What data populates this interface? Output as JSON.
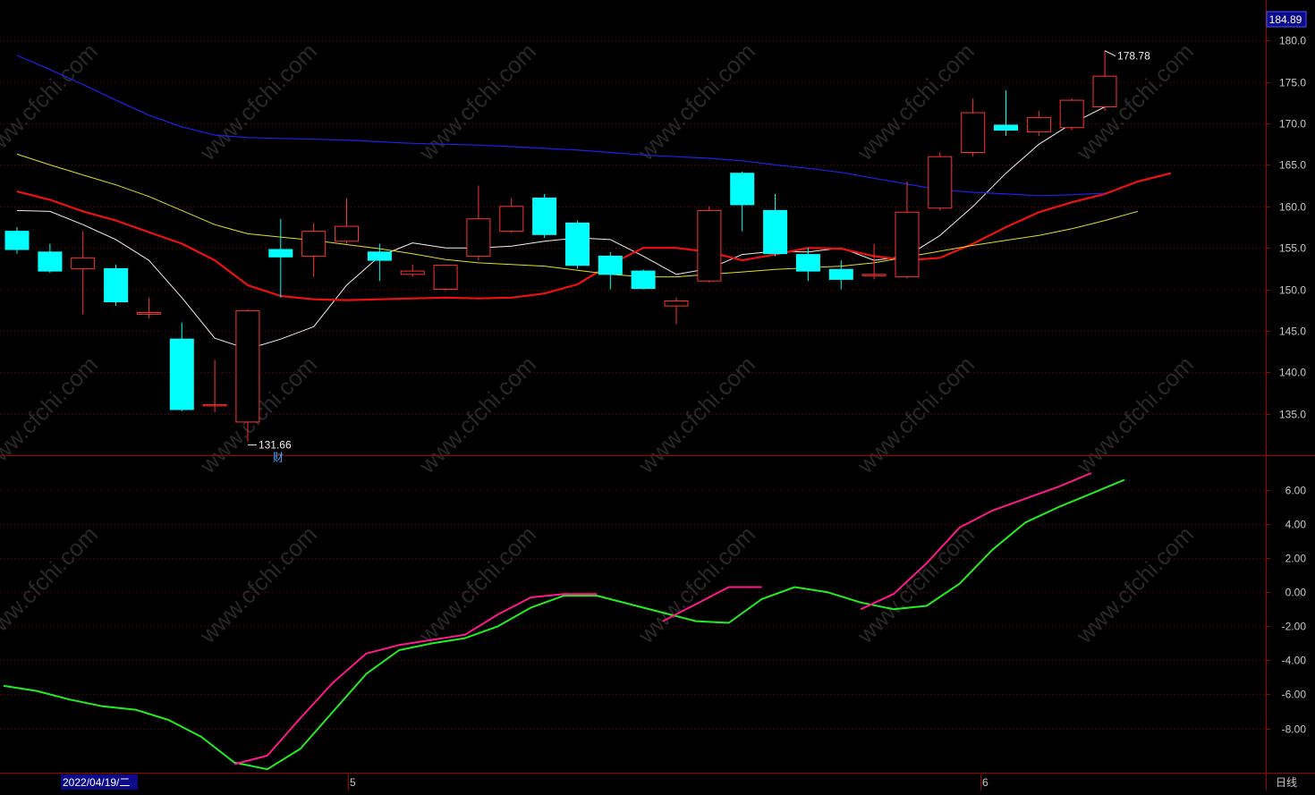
{
  "colors": {
    "background": "#000000",
    "frame": "#a00000",
    "grid": "#7a0000",
    "up_candle": "#ff3232",
    "down_candle": "#00ffff",
    "ma5": "#f0f0f0",
    "ma10": "#ee1111",
    "ma20": "#e0e020",
    "ma60": "#2020ee",
    "osc_fast": "#ff1a8c",
    "osc_slow": "#22ee22",
    "text": "#c8c8c8",
    "price_badge_bg": "#0a0a8a"
  },
  "watermark": "www.cfchi.com",
  "price_axis": {
    "top_price_badge": "184.89",
    "tick_labels": [
      "180.0",
      "175.0",
      "170.0",
      "165.0",
      "160.0",
      "155.0",
      "150.0",
      "145.0",
      "140.0",
      "135.0"
    ]
  },
  "osc_axis": {
    "tick_labels": [
      "6.00",
      "4.00",
      "2.00",
      "0.00",
      "-2.00",
      "-4.00",
      "-6.00",
      "-8.00"
    ]
  },
  "annotations": {
    "high_label": "178.78",
    "low_label": "131.66",
    "finance_marker": "财"
  },
  "bottom_bar": {
    "date_label": "2022/04/19/二",
    "month_mark_1": "5",
    "month_mark_2": "6",
    "period_label": "日线"
  },
  "chart_data": [
    {
      "type": "candlestick",
      "title": "",
      "ylim": [
        130,
        184.89
      ],
      "grid": true,
      "candles": [
        {
          "o": 157.0,
          "h": 157.5,
          "l": 154.3,
          "c": 154.8
        },
        {
          "o": 154.5,
          "h": 155.5,
          "l": 152.0,
          "c": 152.2
        },
        {
          "o": 152.5,
          "h": 157.0,
          "l": 147.0,
          "c": 153.8
        },
        {
          "o": 152.5,
          "h": 153.0,
          "l": 148.0,
          "c": 148.5
        },
        {
          "o": 147.0,
          "h": 149.0,
          "l": 146.5,
          "c": 147.2
        },
        {
          "o": 144.0,
          "h": 146.0,
          "l": 135.3,
          "c": 135.5
        },
        {
          "o": 136.0,
          "h": 141.5,
          "l": 135.2,
          "c": 136.1
        },
        {
          "o": 134.0,
          "h": 147.6,
          "l": 131.66,
          "c": 147.4
        },
        {
          "o": 154.8,
          "h": 158.5,
          "l": 149.0,
          "c": 153.9
        },
        {
          "o": 154.0,
          "h": 158.0,
          "l": 151.5,
          "c": 157.0
        },
        {
          "o": 155.8,
          "h": 161.0,
          "l": 155.5,
          "c": 157.6
        },
        {
          "o": 154.5,
          "h": 155.5,
          "l": 151.0,
          "c": 153.5
        },
        {
          "o": 151.8,
          "h": 153.0,
          "l": 151.5,
          "c": 152.2
        },
        {
          "o": 150.0,
          "h": 153.0,
          "l": 149.8,
          "c": 152.9
        },
        {
          "o": 154.0,
          "h": 162.5,
          "l": 153.5,
          "c": 158.5
        },
        {
          "o": 157.0,
          "h": 161.0,
          "l": 156.8,
          "c": 160.0
        },
        {
          "o": 161.0,
          "h": 161.5,
          "l": 156.2,
          "c": 156.6
        },
        {
          "o": 158.0,
          "h": 158.3,
          "l": 152.5,
          "c": 152.9
        },
        {
          "o": 154.0,
          "h": 154.5,
          "l": 150.0,
          "c": 151.8
        },
        {
          "o": 152.2,
          "h": 152.4,
          "l": 150.0,
          "c": 150.1
        },
        {
          "o": 148.0,
          "h": 149.0,
          "l": 145.8,
          "c": 148.6
        },
        {
          "o": 151.0,
          "h": 160.0,
          "l": 150.8,
          "c": 159.5
        },
        {
          "o": 164.0,
          "h": 164.2,
          "l": 157.0,
          "c": 160.2
        },
        {
          "o": 159.5,
          "h": 161.5,
          "l": 154.0,
          "c": 154.3
        },
        {
          "o": 154.2,
          "h": 155.0,
          "l": 151.0,
          "c": 152.2
        },
        {
          "o": 152.4,
          "h": 153.5,
          "l": 150.0,
          "c": 151.2
        },
        {
          "o": 151.7,
          "h": 155.5,
          "l": 151.2,
          "c": 151.8
        },
        {
          "o": 151.5,
          "h": 163.0,
          "l": 151.3,
          "c": 159.3
        },
        {
          "o": 159.8,
          "h": 166.5,
          "l": 159.5,
          "c": 166.0
        },
        {
          "o": 166.5,
          "h": 173.0,
          "l": 166.0,
          "c": 171.3
        },
        {
          "o": 169.8,
          "h": 174.0,
          "l": 168.5,
          "c": 169.2
        },
        {
          "o": 169.0,
          "h": 171.5,
          "l": 168.5,
          "c": 170.7
        },
        {
          "o": 169.5,
          "h": 173.0,
          "l": 169.2,
          "c": 172.8
        },
        {
          "o": 172.0,
          "h": 178.78,
          "l": 171.5,
          "c": 175.7
        }
      ],
      "series": [
        {
          "key": "ma5",
          "values": [
            159.5,
            159.4,
            157.8,
            156.0,
            153.5,
            149.0,
            144.1,
            142.8,
            144.0,
            145.5,
            150.5,
            154.0,
            155.6,
            155.0,
            155.0,
            155.2,
            155.8,
            156.2,
            156.0,
            154.0,
            151.8,
            152.5,
            154.2,
            154.6,
            154.5,
            155.0,
            153.5,
            154.0,
            156.5,
            160.0,
            164.0,
            167.5,
            170.0,
            172.0
          ]
        },
        {
          "key": "ma10",
          "values": [
            161.8,
            160.8,
            159.4,
            158.3,
            156.9,
            155.5,
            153.5,
            150.5,
            149.2,
            148.8,
            148.7,
            148.8,
            148.9,
            149.0,
            148.9,
            149.0,
            149.5,
            150.6,
            153.0,
            155.0,
            155.0,
            154.5,
            153.5,
            154.2,
            155.0,
            154.9,
            154.0,
            153.5,
            153.8,
            155.5,
            157.5,
            159.3,
            160.5,
            161.5,
            163.0,
            164.0
          ]
        },
        {
          "key": "ma20",
          "values": [
            166.3,
            165.0,
            163.8,
            162.6,
            161.2,
            159.5,
            157.8,
            156.7,
            156.3,
            155.9,
            155.4,
            154.9,
            154.3,
            153.6,
            153.2,
            153.0,
            152.8,
            152.3,
            151.8,
            151.5,
            151.5,
            151.8,
            152.1,
            152.4,
            152.6,
            152.8,
            153.2,
            153.9,
            154.6,
            155.3,
            155.9,
            156.5,
            157.3,
            158.3,
            159.4
          ]
        },
        {
          "key": "ma60",
          "values": [
            178.2,
            176.5,
            174.7,
            172.8,
            171.0,
            169.6,
            168.6,
            168.3,
            168.2,
            168.1,
            168.0,
            167.8,
            167.6,
            167.5,
            167.4,
            167.2,
            167.0,
            166.8,
            166.5,
            166.2,
            166.0,
            165.8,
            165.5,
            165.0,
            164.6,
            164.1,
            163.4,
            162.7,
            162.0,
            161.7,
            161.5,
            161.3,
            161.4,
            161.6
          ]
        }
      ]
    },
    {
      "type": "line",
      "title": "",
      "ylim": [
        -10.6,
        8.0
      ],
      "grid": true,
      "series": [
        {
          "key": "osc_slow",
          "values": [
            -5.5,
            -5.8,
            -6.3,
            -6.7,
            -6.9,
            -7.5,
            -8.5,
            -10.0,
            -10.4,
            -9.2,
            -7.0,
            -4.8,
            -3.4,
            -3.0,
            -2.7,
            -2.0,
            -0.9,
            -0.2,
            -0.2,
            -0.7,
            -1.2,
            -1.7,
            -1.8,
            -0.4,
            0.3,
            0.0,
            -0.6,
            -1.0,
            -0.8,
            0.5,
            2.5,
            4.1,
            5.0,
            5.8,
            6.6
          ]
        },
        {
          "key": "osc_fast",
          "segments": [
            [
              7,
              7,
              [
                -10.1,
                -9.6,
                -7.4,
                -5.3,
                -3.6,
                -3.1,
                -2.8,
                -2.5,
                -1.3,
                -0.3,
                -0.1,
                -0.1
              ]
            ],
            [
              20,
              20,
              [
                -1.7,
                -0.7,
                0.3,
                0.3
              ]
            ],
            [
              26,
              26,
              [
                -1.0,
                -0.1,
                1.7,
                3.8,
                4.8,
                5.5,
                6.2,
                7.0
              ]
            ]
          ]
        }
      ]
    }
  ]
}
